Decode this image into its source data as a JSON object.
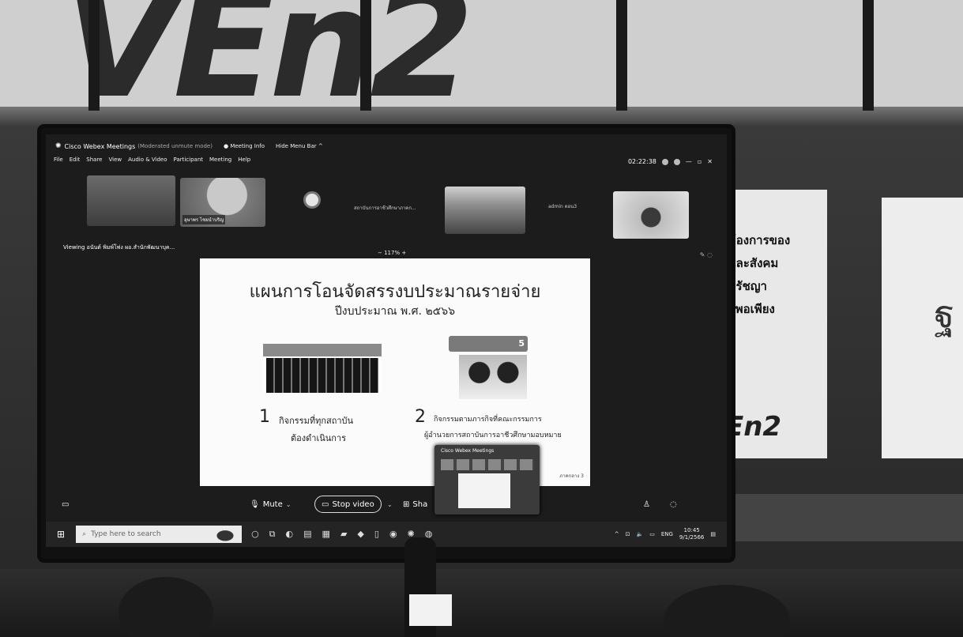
{
  "webex": {
    "app_title": "Cisco Webex Meetings",
    "mode": "(Moderated unmute mode)",
    "meeting_info": "Meeting Info",
    "hide_menu_bar": "Hide Menu Bar ^",
    "clock": "02:22:38",
    "menu": [
      "File",
      "Edit",
      "Share",
      "View",
      "Audio & Video",
      "Participant",
      "Meeting",
      "Help"
    ],
    "participants": [
      {
        "label": ""
      },
      {
        "label": "อุษาพร ไชยนำบริญ"
      },
      {
        "label": "สถาบันการอาชีวศึกษาภาคก..."
      },
      {
        "label": "admin ตอน3"
      }
    ],
    "viewing": "Viewing อนันต์ พิมพ์โพ่ง ผอ.สำนักพัฒนาบุค...",
    "zoom": "−  117%  +",
    "popup_title": "Cisco Webex Meetings"
  },
  "slide": {
    "title": "แผนการโอนจัดสรรงบประมาณรายจ่าย",
    "subtitle": "ปีงบประมาณ พ.ศ. ๒๕๖๖",
    "badge": "5",
    "item1_num": "1",
    "item1_line1": "กิจกรรมที่ทุกสถาบัน",
    "item1_line2": "ต้องดำเนินการ",
    "item2_num": "2",
    "item2_line1": "กิจกรรมตามภารกิจที่คณะกรรมการ",
    "item2_line2": "ผู้อำนวยการสถาบันการอาชีวศึกษามอบหมาย",
    "footer": "ภาคกลาง 3"
  },
  "controls": {
    "mute": "Mute",
    "stop_video": "Stop video",
    "share": "Sha"
  },
  "taskbar": {
    "search_placeholder": "Type here to search",
    "lang": "ENG",
    "time": "10:45",
    "date": "9/1/2566"
  },
  "room": {
    "banner_right": "ต้องการของ\nและสังคม\nปรัชญา\nจพอเพียง",
    "banner_right_brand": "En2"
  }
}
